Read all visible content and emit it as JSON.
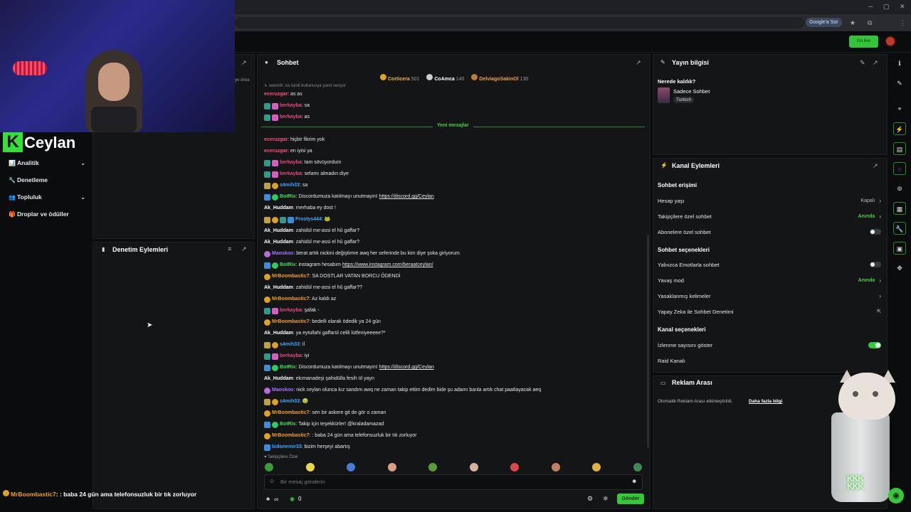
{
  "browser": {
    "google_pill": "Google'a Sor",
    "win_min": "─",
    "win_max": "▢",
    "win_close": "✕",
    "star": "★",
    "ext": "⧉",
    "menu": "⋮"
  },
  "appbar": {
    "golive": "Go live"
  },
  "brand": {
    "logo_letter": "K",
    "logo_text": "Ceylan"
  },
  "leftnav": {
    "items": [
      {
        "icon": "📊",
        "label": "Analitik",
        "has_chevron": true
      },
      {
        "icon": "🔧",
        "label": "Denetleme",
        "has_chevron": false
      },
      {
        "icon": "👥",
        "label": "Topluluk",
        "has_chevron": true
      },
      {
        "icon": "🎁",
        "label": "Droplar ve ödüller",
        "has_chevron": false
      }
    ],
    "chevron": "⌄"
  },
  "mod_actions": {
    "title": "Denetim Eylemleri",
    "topbar_time": "ye önce"
  },
  "chat": {
    "title": "Sohbet",
    "leaderboard": [
      {
        "name": "Corticera",
        "count": "501"
      },
      {
        "name": "CoAmca",
        "count": "140"
      },
      {
        "name": "DelviagoSakinOl",
        "count": "130"
      }
    ],
    "reply_hint": "↳ seemih: sa isimli kullanıcıya yanıt veriyor",
    "new_messages": "Yeni mesajlar",
    "messages": [
      {
        "user": "eceruzgar",
        "color": "#ff4d7a",
        "badges": [],
        "text": ": as as"
      },
      {
        "user": "berkayba",
        "color": "#e5487a",
        "badges": [
          "mod",
          "sub"
        ],
        "text": ": sa"
      },
      {
        "user": "berkayba",
        "color": "#e5487a",
        "badges": [
          "mod",
          "sub"
        ],
        "text": ": as"
      },
      {
        "user": "eceruzgar",
        "color": "#ff4d7a",
        "badges": [],
        "text": ": hiçbir fikrim yok"
      },
      {
        "user": "eceruzgar",
        "color": "#ff4d7a",
        "badges": [],
        "text": ": en iyisi ya"
      },
      {
        "user": "berkayba",
        "color": "#e5487a",
        "badges": [
          "mod",
          "sub"
        ],
        "text": ": tam sövüyordum"
      },
      {
        "user": "berkayba",
        "color": "#e5487a",
        "badges": [
          "mod",
          "sub"
        ],
        "text": ": selamı almadın diye"
      },
      {
        "user": "s4mih33",
        "color": "#3da6ff",
        "badges": [
          "kick",
          "gold"
        ],
        "text": ": sa"
      },
      {
        "user": "BotRix",
        "color": "#3ddc57",
        "badges": [
          "bot",
          "ver"
        ],
        "text": ": Discordumuza katılmayı unutmayın! ",
        "link": "https://discord.gg/Ceylan"
      },
      {
        "user": "Ak_Huddam",
        "color": "#ffffff",
        "badges": [],
        "text": ": merhaba ey dost !"
      },
      {
        "user": "Frostys444",
        "color": "#3da6ff",
        "badges": [
          "kick",
          "gold",
          "mod",
          "bot"
        ],
        "text": ": 🐸"
      },
      {
        "user": "Ak_Huddam",
        "color": "#ffffff",
        "badges": [],
        "text": ": zahidül me-assi el hû gaffar?"
      },
      {
        "user": "Ak_Huddam",
        "color": "#ffffff",
        "badges": [],
        "text": ": zahidül me-assi el hû gaffar?"
      },
      {
        "user": "Maoskoo",
        "color": "#a970ff",
        "badges": [
          "og"
        ],
        "text": ": berat artık nickini değiştirme awq her seferinde bu kim diye şoka giriyorum"
      },
      {
        "user": "BotRix",
        "color": "#3ddc57",
        "badges": [
          "bot",
          "ver"
        ],
        "text": ": instagram hesabım ",
        "link": "https://www.instagram.com/beraatceylan/"
      },
      {
        "user": "MrBoombastic7",
        "color": "#f0a01e",
        "badges": [
          "gold"
        ],
        "text": ": SA DOSTLAR VATAN BORCU ÖDENDİ"
      },
      {
        "user": "Ak_Huddam",
        "color": "#ffffff",
        "badges": [],
        "text": ": zahidül me-assi el hû gaffar??"
      },
      {
        "user": "MrBoombastic7",
        "color": "#f0a01e",
        "badges": [
          "gold"
        ],
        "text": ": Az kaldı az"
      },
      {
        "user": "berkayba",
        "color": "#e5487a",
        "badges": [
          "mod",
          "sub"
        ],
        "text": ": şafak -"
      },
      {
        "user": "MrBoombastic7",
        "color": "#f0a01e",
        "badges": [
          "gold"
        ],
        "text": ": bedelli olarak ödedik ya 24 gün"
      },
      {
        "user": "Ak_Huddam",
        "color": "#ffffff",
        "badges": [],
        "text": ": ya eytullahi gaffarül celili lütfeniyeeeee?*"
      },
      {
        "user": "s4mih33",
        "color": "#3da6ff",
        "badges": [
          "kick",
          "gold"
        ],
        "text": ": il"
      },
      {
        "user": "berkayba",
        "color": "#e5487a",
        "badges": [
          "mod",
          "sub"
        ],
        "text": ": iyi"
      },
      {
        "user": "BotRix",
        "color": "#3ddc57",
        "badges": [
          "bot",
          "ver"
        ],
        "text": ": Discordumuza katılmayı unutmayın! ",
        "link": "https://discord.gg/Ceylan"
      },
      {
        "user": "Ak_Huddam",
        "color": "#ffffff",
        "badges": [],
        "text": ": ekımanadeşi şahidülla fesih ül yayn"
      },
      {
        "user": "Maoskoo",
        "color": "#a970ff",
        "badges": [
          "og"
        ],
        "text": ": nick ceylan olunca kız sandım awq ne zaman takip ettim dedim bide şu adamı banla artık chat paatlayacak aeq"
      },
      {
        "user": "s4mih33",
        "color": "#3da6ff",
        "badges": [
          "kick",
          "gold"
        ],
        "text": ": 🤢"
      },
      {
        "user": "MrBoombastic7",
        "color": "#f0a01e",
        "badges": [
          "gold"
        ],
        "text": ": sen bir askere git de gör o zaman"
      },
      {
        "user": "BotRix",
        "color": "#3ddc57",
        "badges": [
          "bot",
          "ver"
        ],
        "text": ": Takip için teşekkürler! @kraladamazad"
      },
      {
        "user": "MrBoombastic7",
        "color": "#f0a01e",
        "badges": [
          "gold"
        ],
        "text": ": : baba 24 gün ama telefonsuzluk bir tık zorluyor"
      },
      {
        "user": "bidonemir33",
        "color": "#3da6ff",
        "badges": [
          "bot"
        ],
        "text": ": bizim herşeyi abartış"
      }
    ],
    "followers_only": "♥ Takipçilere Özel",
    "input_placeholder": "Bir mesaj gönderin",
    "viewer_count": "0",
    "infinity": "∞",
    "send": "Gönder"
  },
  "stream_info": {
    "title": "Yayın bilgisi",
    "where_label": "Nerede kaldık?",
    "category": "Sadece Sohbet",
    "language_tag": "Turkish"
  },
  "channel_actions": {
    "title": "Kanal Eylemleri",
    "chat_access": "Sohbet erişimi",
    "account_age": {
      "label": "Hesap yaşı",
      "value": "Kapalı"
    },
    "followers_chat": {
      "label": "Takipçilere özel sohbet",
      "value": "Anında"
    },
    "subs_chat": {
      "label": "Abonelere özel sohbet",
      "on": false
    },
    "chat_options": "Sohbet seçenekleri",
    "emotes_only": {
      "label": "Yalnızca Emotlarla sohbet",
      "on": false
    },
    "slow_mode": {
      "label": "Yavaş mod",
      "value": "Anında"
    },
    "banned_words": {
      "label": "Yasaklanmış kelimeler"
    },
    "ai_mod": {
      "label": "Yapay Zeka ile Sohbet Denetimi"
    },
    "channel_options": "Kanal seçenekleri",
    "show_viewers": {
      "label": "İzlenme sayısını göster",
      "on": true
    },
    "raid": {
      "label": "Raid Kanalı"
    }
  },
  "ad_break": {
    "title": "Reklam Arası",
    "text": "Otomatik Reklam Arası etkinleştirildi.",
    "link": "Daha fazla bilgi"
  },
  "overlay": {
    "kkk": "KKK\nKKK",
    "bottom_user": "MrBoombastic7",
    "bottom_text": ": : baba 24 gün ama telefonsuzluk bir tık zorluyor"
  },
  "colors": {
    "accent": "#35c939",
    "panel": "#141517",
    "bg": "#0b0c0d"
  }
}
